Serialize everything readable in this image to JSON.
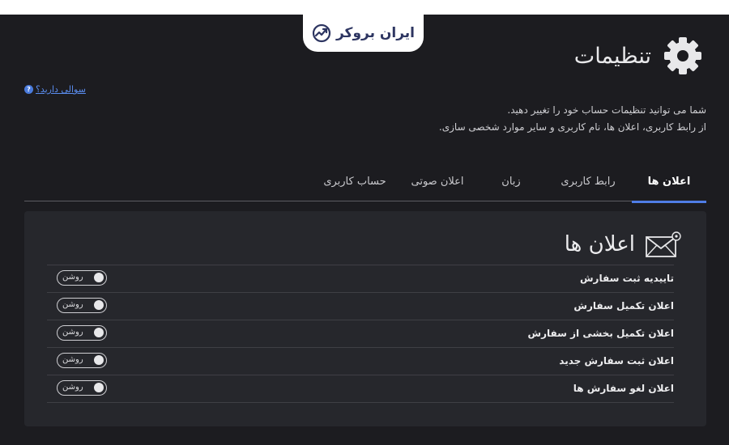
{
  "brand": {
    "name": "ایران بروکر"
  },
  "page": {
    "title": "تنظیمات"
  },
  "help": {
    "badge": "?",
    "label": "سوالی دارید؟"
  },
  "description": {
    "line1": "شما می توانید تنظیمات حساب خود را تغییر دهید.",
    "line2": "از رابط کاربری، اعلان ها، نام کاربری و سایر موارد شخصی سازی."
  },
  "tabs": [
    {
      "label": "اعلان ها",
      "active": true
    },
    {
      "label": "رابط کاربری",
      "active": false
    },
    {
      "label": "زبان",
      "active": false
    },
    {
      "label": "اعلان صوتی",
      "active": false
    },
    {
      "label": "حساب کاربری",
      "active": false
    }
  ],
  "section": {
    "title": "اعلان ها",
    "icon": "envelope-icon"
  },
  "notifications": [
    {
      "label": "تاییدیه ثبت سفارش",
      "toggle_text": "روشن",
      "on": true
    },
    {
      "label": "اعلان تکمیل سفارش",
      "toggle_text": "روشن",
      "on": true
    },
    {
      "label": "اعلان تکمیل بخشی از سفارش",
      "toggle_text": "روشن",
      "on": true
    },
    {
      "label": "اعلان ثبت سفارش جدید",
      "toggle_text": "روشن",
      "on": true
    },
    {
      "label": "اعلان لغو سفارش ها",
      "toggle_text": "روشن",
      "on": true
    }
  ],
  "colors": {
    "background": "#1c1c20",
    "panel": "#26272c",
    "accent": "#4f7de6",
    "link": "#5a8df0",
    "brand": "#2d3561"
  }
}
